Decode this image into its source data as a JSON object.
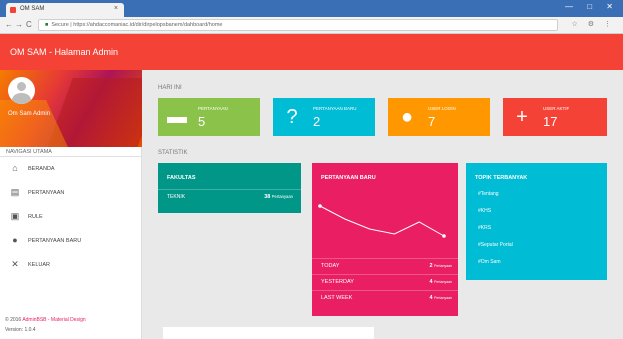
{
  "browser": {
    "tab_title": "OM SAM",
    "tab_close": "×",
    "url_secure": "Secure",
    "url": "https://ahdaccomaniac.id/dir/dirpelopsbanem/dahboard/home",
    "nav_back": "←",
    "nav_forward": "→",
    "nav_reload": "C",
    "addr_icons": "☆ ⚙ ⋮",
    "win_controls": "— □ ✕"
  },
  "app": {
    "title": "OM SAM - Halaman Admin"
  },
  "sidebar": {
    "username": "Om Sam Admin",
    "menu_header": "NAVIGASI UTAMA",
    "items": [
      {
        "label": "BERANDA",
        "icon": "⌂"
      },
      {
        "label": "PERTANYAAN",
        "icon": "▤"
      },
      {
        "label": "RULE",
        "icon": "▣"
      },
      {
        "label": "PERTANYAAN BARU",
        "icon": "●"
      },
      {
        "label": "KELUAR",
        "icon": "✕"
      }
    ],
    "footer_prefix": "© 2016 ",
    "footer_brand": "AdminBSB - Material Design",
    "version": "Version: 1.0.4"
  },
  "main": {
    "hari_ini_label": "HARI INI",
    "statistik_label": "STATISTIK",
    "info_boxes": [
      {
        "label": "PERTANYAAN",
        "value": "5",
        "color": "#8bc34a",
        "icon": "▬"
      },
      {
        "label": "PERTANYAAN BARU",
        "value": "2",
        "color": "#00bcd4",
        "icon": "?"
      },
      {
        "label": "USER LOGIN",
        "value": "7",
        "color": "#ff9800",
        "icon": "●"
      },
      {
        "label": "USER AKTIF",
        "value": "17",
        "color": "#f44336",
        "icon": "+"
      }
    ],
    "fakultas": {
      "title": "FAKULTAS",
      "row_label": "TEKNIK",
      "row_value": "38",
      "row_unit": "Pertanyaan"
    },
    "pertanyaan_baru": {
      "title": "PERTANYAAN BARU",
      "rows": [
        {
          "label": "TODAY",
          "value": "2",
          "unit": "Pertanyaan"
        },
        {
          "label": "YESTERDAY",
          "value": "4",
          "unit": "Pertanyaan"
        },
        {
          "label": "LAST WEEK",
          "value": "4",
          "unit": "Pertanyaan"
        }
      ]
    },
    "topik": {
      "title": "TOPIK TERBANYAK",
      "items": [
        "#Tentang",
        "#KHS",
        "#KRS",
        "#Seputar Portal",
        "#Om Sam"
      ]
    }
  },
  "chart_data": {
    "type": "line",
    "x": [
      1,
      2,
      3,
      4,
      5,
      6
    ],
    "y": [
      4.5,
      3.2,
      2.2,
      1.7,
      2.9,
      1.5
    ],
    "ylim": [
      0,
      6
    ],
    "color": "#ffffff"
  }
}
